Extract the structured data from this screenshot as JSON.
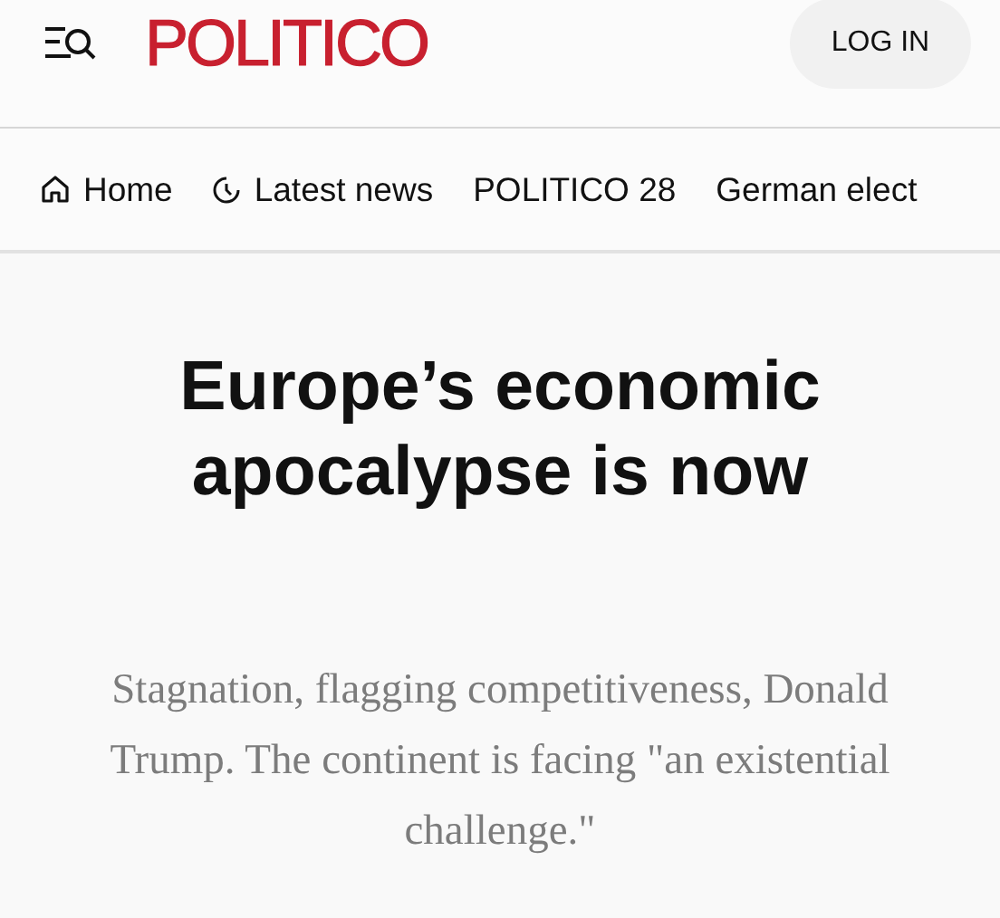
{
  "header": {
    "logo": "POLITICO",
    "login_button": "LOG IN"
  },
  "nav": [
    {
      "label": "Home",
      "kind": "home"
    },
    {
      "label": "Latest news",
      "kind": "latest"
    },
    {
      "label": "POLITICO 28",
      "kind": "section"
    },
    {
      "label": "German elect",
      "kind": "section"
    }
  ],
  "article": {
    "headline": "Europe’s economic apocalypse is now",
    "dek": "Stagnation, flagging competitiveness, Donald Trump. The continent is facing \"an existential challenge.\""
  }
}
